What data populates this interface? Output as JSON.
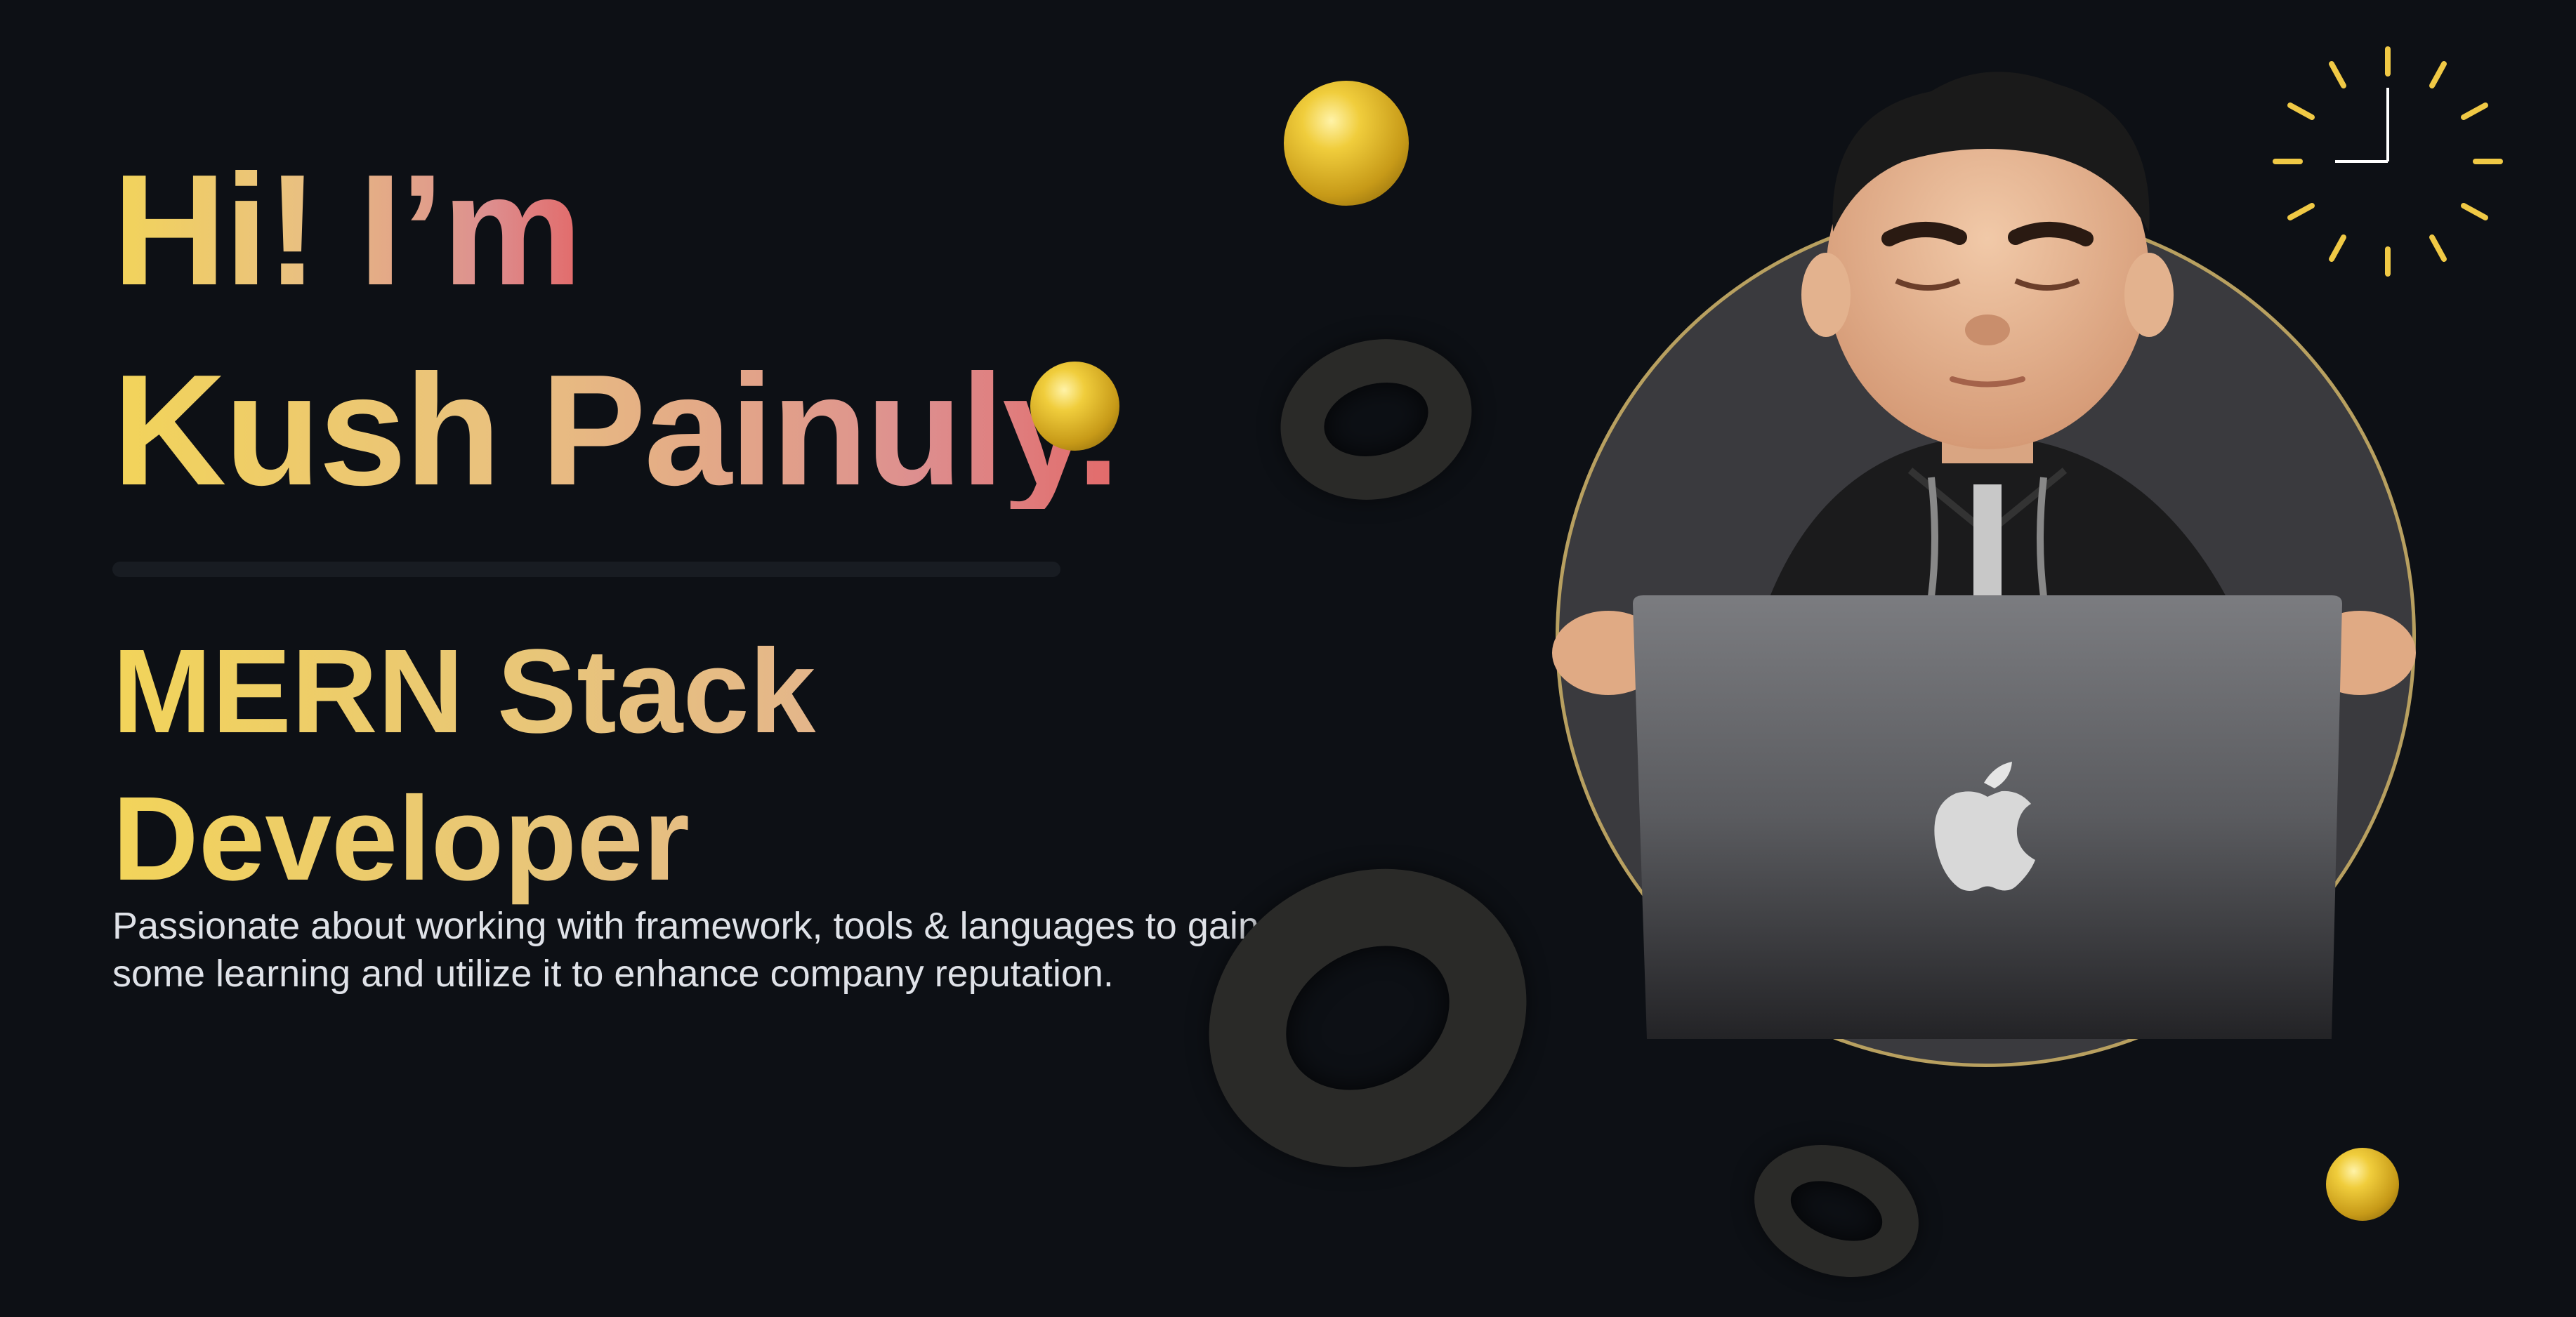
{
  "hero": {
    "greeting": "Hi! I’m",
    "name": "Kush Painuly.",
    "role": "MERN Stack Developer",
    "bio": "Passionate about working with framework, tools & languages to gain some learning and utilize it to enhance company reputation."
  },
  "colors": {
    "background": "#0d1015",
    "accent_gold": "#f2d45a",
    "accent_pink": "#e26a6a",
    "ball_gold": "#e6c030",
    "disc": "#3a3a3e"
  },
  "icons": [
    "clock-icon",
    "apple-logo-icon"
  ]
}
